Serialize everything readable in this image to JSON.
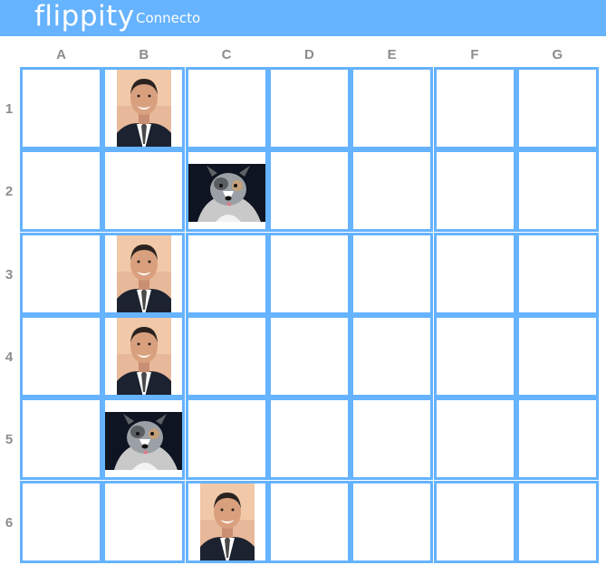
{
  "header": {
    "logo": "flippity",
    "app_name": "Connecto"
  },
  "columns": [
    "A",
    "B",
    "C",
    "D",
    "E",
    "F",
    "G"
  ],
  "rows": [
    "1",
    "2",
    "3",
    "4",
    "5",
    "6"
  ],
  "pieces": [
    {
      "row": 1,
      "col": "B",
      "type": "person"
    },
    {
      "row": 2,
      "col": "C",
      "type": "dog"
    },
    {
      "row": 3,
      "col": "B",
      "type": "person"
    },
    {
      "row": 4,
      "col": "B",
      "type": "person"
    },
    {
      "row": 5,
      "col": "B",
      "type": "dog"
    },
    {
      "row": 6,
      "col": "C",
      "type": "person"
    }
  ],
  "colors": {
    "header_bg": "#66b3ff",
    "grid_line": "#66b3ff",
    "label": "#8c8c8c"
  }
}
